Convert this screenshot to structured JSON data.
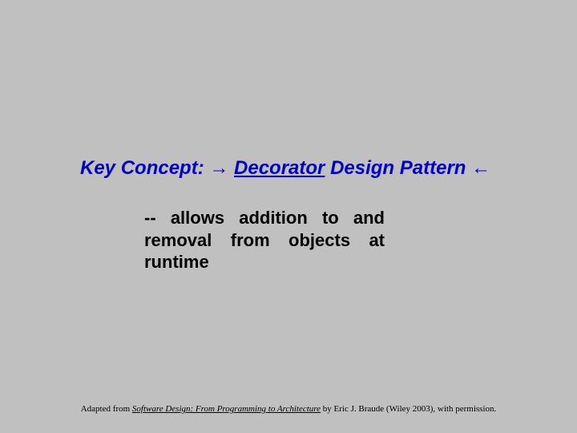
{
  "title": {
    "prefix": "Key Concept: ",
    "arrow_right": "→",
    "space": "  ",
    "underlined": "Decorator",
    "suffix": " Design Pattern ",
    "arrow_left": "←"
  },
  "body": "-- allows addition to and removal from objects at runtime",
  "attribution": {
    "prefix": "Adapted from ",
    "book_title": "Software Design: From Programming to Architecture",
    "suffix": " by Eric J. Braude (Wiley 2003), with permission."
  }
}
